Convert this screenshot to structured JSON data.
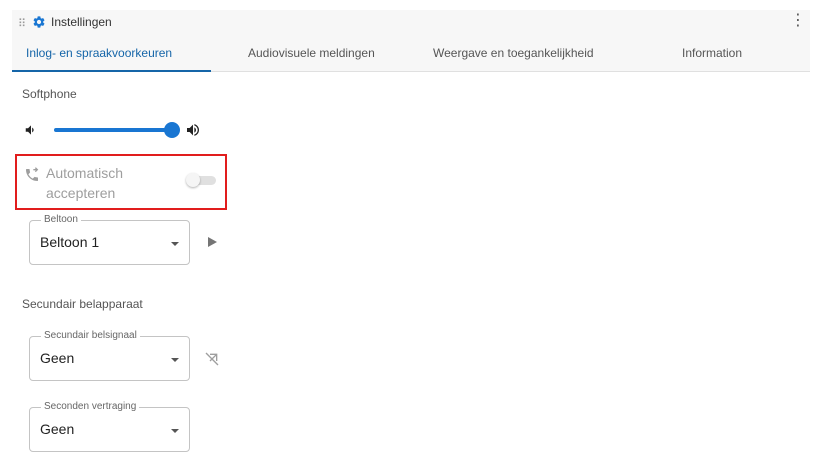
{
  "header": {
    "title": "Instellingen",
    "icons": {
      "drag": "drag-handle-icon",
      "settings": "gear-icon",
      "menu": "more-vert-icon"
    },
    "accent_color": "#1565a8"
  },
  "tabs": [
    {
      "label": "Inlog- en spraakvoorkeuren",
      "active": true
    },
    {
      "label": "Audiovisuele meldingen",
      "active": false
    },
    {
      "label": "Weergave en toegankelijkheid",
      "active": false
    },
    {
      "label": "Information",
      "active": false
    }
  ],
  "softphone": {
    "section_title": "Softphone",
    "volume_level": 1.0,
    "auto_accept": {
      "label": "Automatisch accepteren",
      "enabled": false,
      "highlight_color": "#e11d1d"
    },
    "ringtone": {
      "label": "Beltoon",
      "value": "Beltoon 1"
    }
  },
  "secondary_device": {
    "section_title": "Secundair belapparaat",
    "signal": {
      "label": "Secundair belsignaal",
      "value": "Geen"
    },
    "delay": {
      "label": "Seconden vertraging",
      "value": "Geen"
    }
  }
}
